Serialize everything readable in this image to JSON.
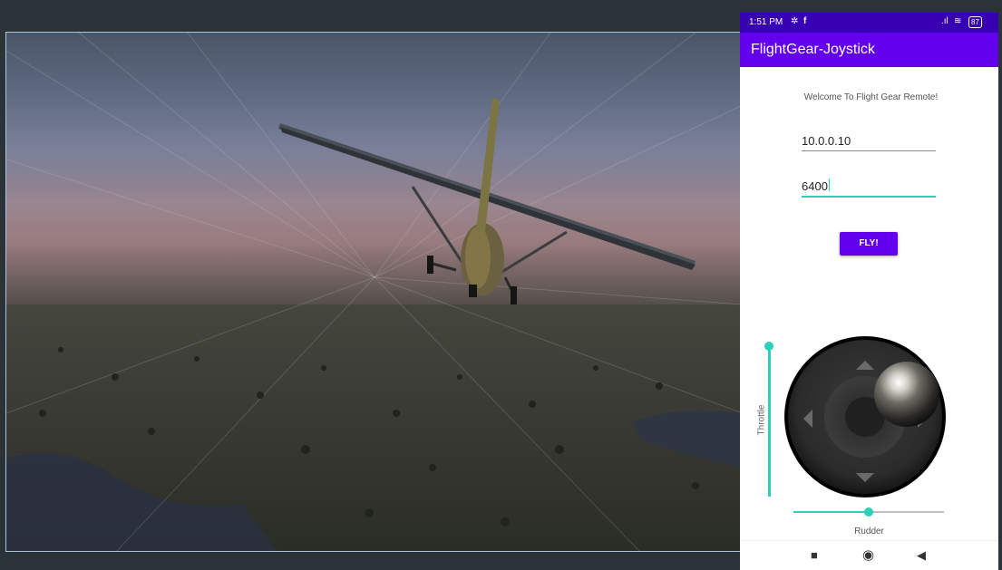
{
  "sim_view": {
    "description_icon": "airplane-icon"
  },
  "phone": {
    "status": {
      "time": "1:51 PM",
      "settings_icon": "✲",
      "facebook_icon": "f",
      "signal_icon": ".ıl",
      "wifi_icon": "≋",
      "battery": "87"
    },
    "app_title": "FlightGear-Joystick",
    "welcome_text": "Welcome To Flight Gear Remote!",
    "ip_value": "10.0.0.10",
    "port_value": "6400",
    "fly_button": "FLY!",
    "throttle_label": "Throttle",
    "throttle_value": 1.0,
    "rudder_label": "Rudder",
    "rudder_value": 0.5,
    "nav": {
      "recents": "■",
      "home": "◉",
      "back": "◀"
    },
    "colors": {
      "primary": "#6200ee",
      "primary_dark": "#3700b3",
      "accent": "#2ccfb8"
    }
  }
}
